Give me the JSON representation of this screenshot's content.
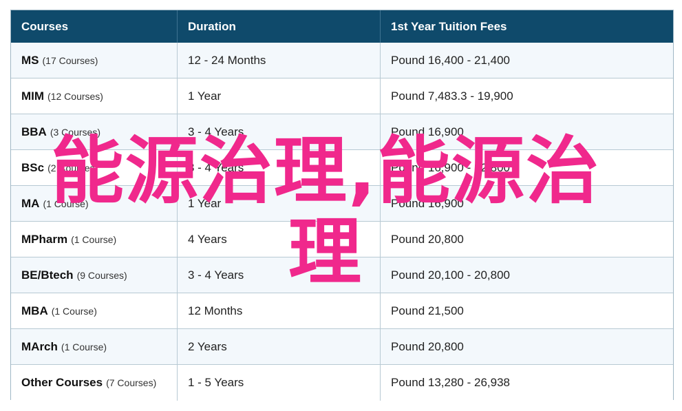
{
  "table": {
    "headers": [
      "Courses",
      "Duration",
      "1st Year Tuition Fees"
    ],
    "rows": [
      {
        "course": "MS",
        "count": "(17 Courses)",
        "duration": "12 - 24 Months",
        "fees": "Pound 16,400 - 21,400"
      },
      {
        "course": "MIM",
        "count": "(12 Courses)",
        "duration": "1 Year",
        "fees": "Pound 7,483.3 - 19,900"
      },
      {
        "course": "BBA",
        "count": "(3 Courses)",
        "duration": "3 - 4 Years",
        "fees": "Pound 16,900"
      },
      {
        "course": "BSc",
        "count": "(2 Courses)",
        "duration": "3 - 4 Years",
        "fees": "Pound 16,900 - 22,800"
      },
      {
        "course": "MA",
        "count": "(1 Course)",
        "duration": "1 Year",
        "fees": "Pound 16,900"
      },
      {
        "course": "MPharm",
        "count": "(1 Course)",
        "duration": "4 Years",
        "fees": "Pound 20,800"
      },
      {
        "course": "BE/Btech",
        "count": "(9 Courses)",
        "duration": "3 - 4 Years",
        "fees": "Pound 20,100 - 20,800"
      },
      {
        "course": "MBA",
        "count": "(1 Course)",
        "duration": "12 Months",
        "fees": "Pound 21,500"
      },
      {
        "course": "MArch",
        "count": "(1 Course)",
        "duration": "2 Years",
        "fees": "Pound 20,800"
      },
      {
        "course": "Other Courses",
        "count": "(7 Courses)",
        "duration": "1 - 5 Years",
        "fees": "Pound 13,280 - 26,938"
      }
    ]
  },
  "overlay": {
    "text": "能源治理,能源治理",
    "color": "#f0288c"
  },
  "colors": {
    "header_bg": "#0f4a6b",
    "row_alt_bg": "#f3f8fc",
    "border": "#b7c9d3"
  }
}
